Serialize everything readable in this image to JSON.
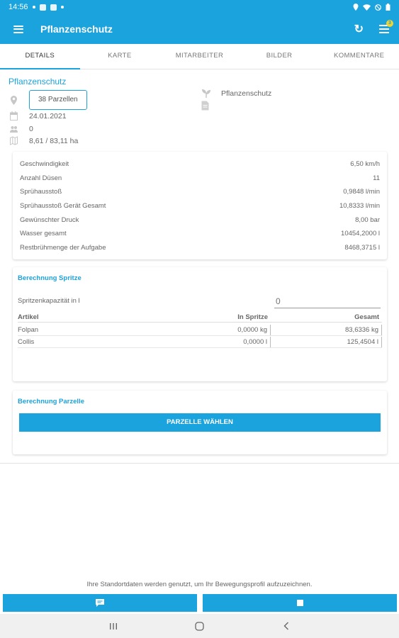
{
  "status_bar": {
    "time": "14:56"
  },
  "app_bar": {
    "title": "Pflanzenschutz",
    "badge_count": "3"
  },
  "tabs": [
    {
      "label": "DETAILS",
      "active": true
    },
    {
      "label": "KARTE"
    },
    {
      "label": "MITARBEITER"
    },
    {
      "label": "BILDER"
    },
    {
      "label": "KOMMENTARE"
    }
  ],
  "details": {
    "title": "Pflanzenschutz",
    "parzellen_button": "38 Parzellen",
    "date": "24.01.2021",
    "workers": "0",
    "area": "8,61 / 83,11 ha",
    "category": "Pflanzenschutz"
  },
  "params": [
    {
      "label": "Geschwindigkeit",
      "value": "6,50 km/h"
    },
    {
      "label": "Anzahl Düsen",
      "value": "11"
    },
    {
      "label": "Sprühausstoß",
      "value": "0,9848 l/min"
    },
    {
      "label": "Sprühausstoß Gerät Gesamt",
      "value": "10,8333 l/min"
    },
    {
      "label": "Gewünschter Druck",
      "value": "8,00 bar"
    },
    {
      "label": "Wasser gesamt",
      "value": "10454,2000 l"
    },
    {
      "label": "Restbrühmenge der Aufgabe",
      "value": "8468,3715 l"
    }
  ],
  "spritze": {
    "title": "Berechnung Spritze",
    "capacity_label": "Spritzenkapazität in l",
    "capacity_placeholder": "0",
    "columns": [
      "Artikel",
      "In Spritze",
      "Gesamt"
    ],
    "rows": [
      [
        "Folpan",
        "0,0000 kg",
        "83,6336 kg"
      ],
      [
        "Collis",
        "0,0000 l",
        "125,4504 l"
      ]
    ]
  },
  "parzelle": {
    "title": "Berechnung Parzelle",
    "button": "PARZELLE WÄHLEN"
  },
  "location_note": "Ihre Standortdaten werden genutzt, um Ihr Bewegungsprofil aufzuzeichnen.",
  "colors": {
    "primary": "#1aa3dc",
    "badge": "#f1d430"
  },
  "icons": [
    "menu-icon",
    "refresh-icon",
    "task-list-icon",
    "location-pin-icon",
    "calendar-icon",
    "people-icon",
    "map-icon",
    "plant-icon",
    "document-icon",
    "chat-icon",
    "stop-icon"
  ]
}
